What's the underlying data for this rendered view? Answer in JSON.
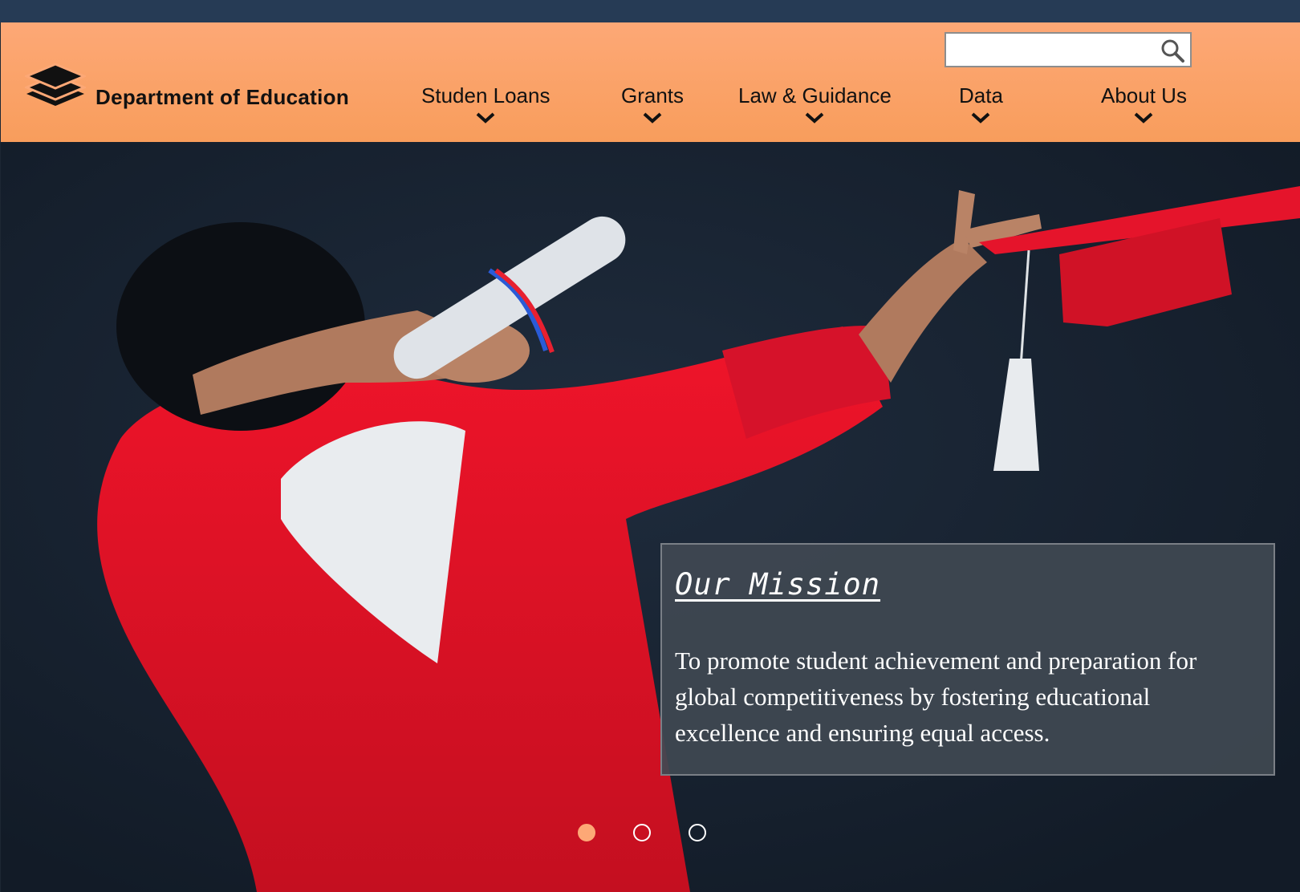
{
  "header": {
    "brand": "Department of Education",
    "logo_icon": "layers-stack-icon",
    "search": {
      "value": "",
      "placeholder": "",
      "icon": "search-icon"
    },
    "nav": [
      {
        "label": "Studen Loans",
        "icon": "chevron-down-icon"
      },
      {
        "label": "Grants",
        "icon": "chevron-down-icon"
      },
      {
        "label": "Law & Guidance",
        "icon": "chevron-down-icon"
      },
      {
        "label": "Data",
        "icon": "chevron-down-icon"
      },
      {
        "label": "About Us",
        "icon": "chevron-down-icon"
      }
    ]
  },
  "hero": {
    "mission_title": "Our Mission",
    "mission_text": "To promote student achievement and preparation for global competitiveness by fostering educational excellence and ensuring equal access.",
    "carousel": {
      "slide_count": 3,
      "active_index": 0
    }
  },
  "colors": {
    "topbar": "#263b55",
    "header": "#fda876",
    "hero_background": "#172232",
    "mission_panel": "#404852",
    "active_dot": "#fda876"
  }
}
